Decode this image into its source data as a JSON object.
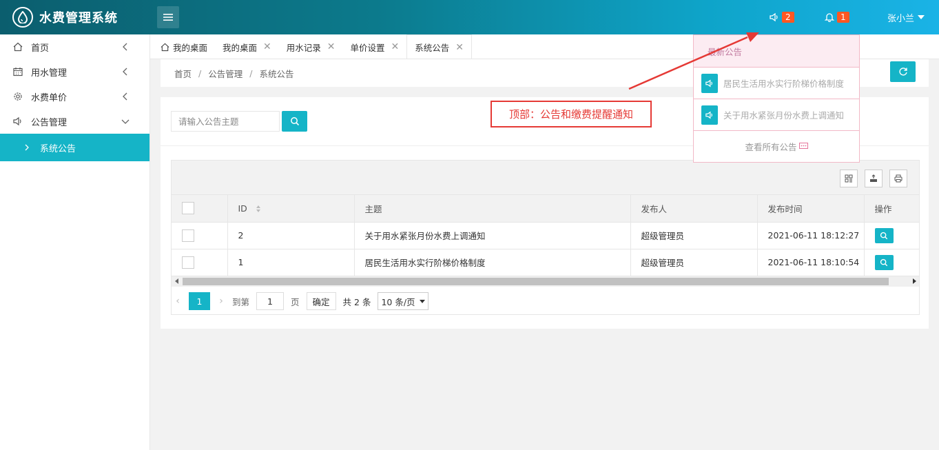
{
  "app": {
    "title": "水费管理系统"
  },
  "header": {
    "notice_count": "2",
    "alert_count": "1",
    "user_name": "张小兰"
  },
  "sidebar": {
    "items": [
      {
        "label": "首页"
      },
      {
        "label": "用水管理"
      },
      {
        "label": "水费单价"
      },
      {
        "label": "公告管理"
      }
    ],
    "sub_item": {
      "label": "系统公告"
    }
  },
  "tabs": [
    {
      "label": "我的桌面"
    },
    {
      "label": "我的桌面"
    },
    {
      "label": "用水记录"
    },
    {
      "label": "单价设置"
    },
    {
      "label": "系统公告"
    }
  ],
  "breadcrumb": [
    "首页",
    "公告管理",
    "系统公告"
  ],
  "search": {
    "placeholder": "请输入公告主题"
  },
  "table": {
    "columns": [
      "ID",
      "主题",
      "发布人",
      "发布时间",
      "操作"
    ],
    "rows": [
      {
        "id": "2",
        "subject": "关于用水紧张月份水费上调通知",
        "publisher": "超级管理员",
        "time": "2021-06-11 18:12:27"
      },
      {
        "id": "1",
        "subject": "居民生活用水实行阶梯价格制度",
        "publisher": "超级管理员",
        "time": "2021-06-11 18:10:54"
      }
    ]
  },
  "pager": {
    "current": "1",
    "goto_label": "到第",
    "goto_value": "1",
    "page_unit": "页",
    "confirm": "确定",
    "total": "共 2 条",
    "page_size": "10 条/页"
  },
  "notice_popup": {
    "title": "最新公告",
    "items": [
      "居民生活用水实行阶梯价格制度",
      "关于用水紧张月份水费上调通知"
    ],
    "footer": "查看所有公告"
  },
  "annotation": {
    "text": "顶部：公告和缴费提醒通知",
    "color": "#e53935"
  },
  "colors": {
    "accent": "#15b4c7",
    "badge": "#ff5722"
  }
}
